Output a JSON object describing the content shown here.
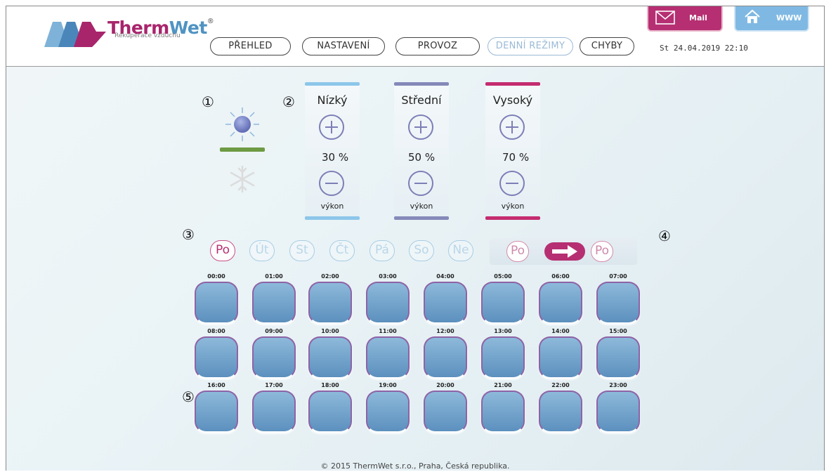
{
  "brand": {
    "name_part1": "Therm",
    "name_part2": "Wet",
    "registered": "®",
    "tagline": "Rekuperace vzduchu"
  },
  "nav": {
    "items": [
      {
        "label": "PŘEHLED"
      },
      {
        "label": "NASTAVENÍ"
      },
      {
        "label": "PROVOZ"
      },
      {
        "label": "DENNÍ REŽIMY",
        "active": true
      },
      {
        "label": "CHYBY"
      }
    ]
  },
  "header": {
    "datetime": "St 24.04.2019  22:10",
    "mail_label": "Mail",
    "www_label": "WWW"
  },
  "callouts": [
    "①",
    "②",
    "③",
    "④",
    "⑤"
  ],
  "levels": [
    {
      "name": "Nízký",
      "value": "30 %",
      "sublabel": "výkon",
      "color": "#8cc6ea"
    },
    {
      "name": "Střední",
      "value": "50 %",
      "sublabel": "výkon",
      "color": "#8589b9"
    },
    {
      "name": "Vysoký",
      "value": "70 %",
      "sublabel": "výkon",
      "color": "#c42c70"
    }
  ],
  "days": [
    {
      "label": "Po",
      "active": true
    },
    {
      "label": "Út"
    },
    {
      "label": "St"
    },
    {
      "label": "Čt"
    },
    {
      "label": "Pá"
    },
    {
      "label": "So"
    },
    {
      "label": "Ne"
    }
  ],
  "copy": {
    "from": "Po",
    "to": "Po"
  },
  "hours": [
    "00:00",
    "01:00",
    "02:00",
    "03:00",
    "04:00",
    "05:00",
    "06:00",
    "07:00",
    "08:00",
    "09:00",
    "10:00",
    "11:00",
    "12:00",
    "13:00",
    "14:00",
    "15:00",
    "16:00",
    "17:00",
    "18:00",
    "19:00",
    "20:00",
    "21:00",
    "22:00",
    "23:00"
  ],
  "footer": "© 2015 ThermWet s.r.o., Praha, Česká republika.",
  "colors": {
    "brand_magenta": "#b62f72",
    "brand_blue": "#4f93c2",
    "mode_green": "#6e9a43",
    "hour_button": "#6f9fc9"
  }
}
